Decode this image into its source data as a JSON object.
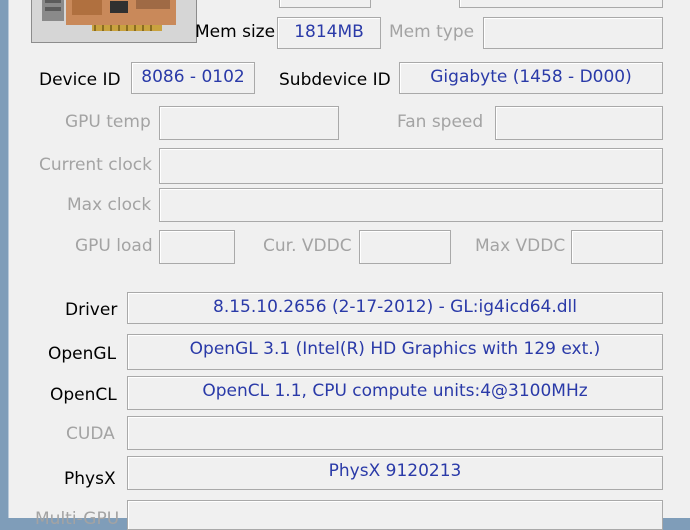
{
  "mem": {
    "size_label": "Mem size",
    "size_value": "1814MB",
    "type_label": "Mem type",
    "type_value": ""
  },
  "device": {
    "id_label": "Device ID",
    "id_value": "8086 - 0102",
    "subdevice_label": "Subdevice ID",
    "subdevice_value": "Gigabyte (1458 - D000)"
  },
  "gpu_temp": {
    "label": "GPU temp",
    "value": ""
  },
  "fan_speed": {
    "label": "Fan speed",
    "value": ""
  },
  "current_clock": {
    "label": "Current clock",
    "value": ""
  },
  "max_clock": {
    "label": "Max clock",
    "value": ""
  },
  "gpu_load": {
    "label": "GPU load",
    "value": ""
  },
  "cur_vddc": {
    "label": "Cur. VDDC",
    "value": ""
  },
  "max_vddc": {
    "label": "Max VDDC",
    "value": ""
  },
  "driver": {
    "label": "Driver",
    "value": "8.15.10.2656 (2-17-2012) - GL:ig4icd64.dll"
  },
  "opengl": {
    "label": "OpenGL",
    "value": "OpenGL 3.1 (Intel(R) HD Graphics with 129 ext.)"
  },
  "opencl": {
    "label": "OpenCL",
    "value": "OpenCL 1.1, CPU compute units:4@3100MHz"
  },
  "cuda": {
    "label": "CUDA",
    "value": ""
  },
  "physx": {
    "label": "PhysX",
    "value": "PhysX 9120213"
  },
  "multi_gpu": {
    "label": "Multi-GPU",
    "value": ""
  },
  "colors": {
    "value_text": "#2a3aa8",
    "disabled_text": "#a3a3a3",
    "panel_bg": "#f0f0f0",
    "window_border": "#7f9db9"
  }
}
